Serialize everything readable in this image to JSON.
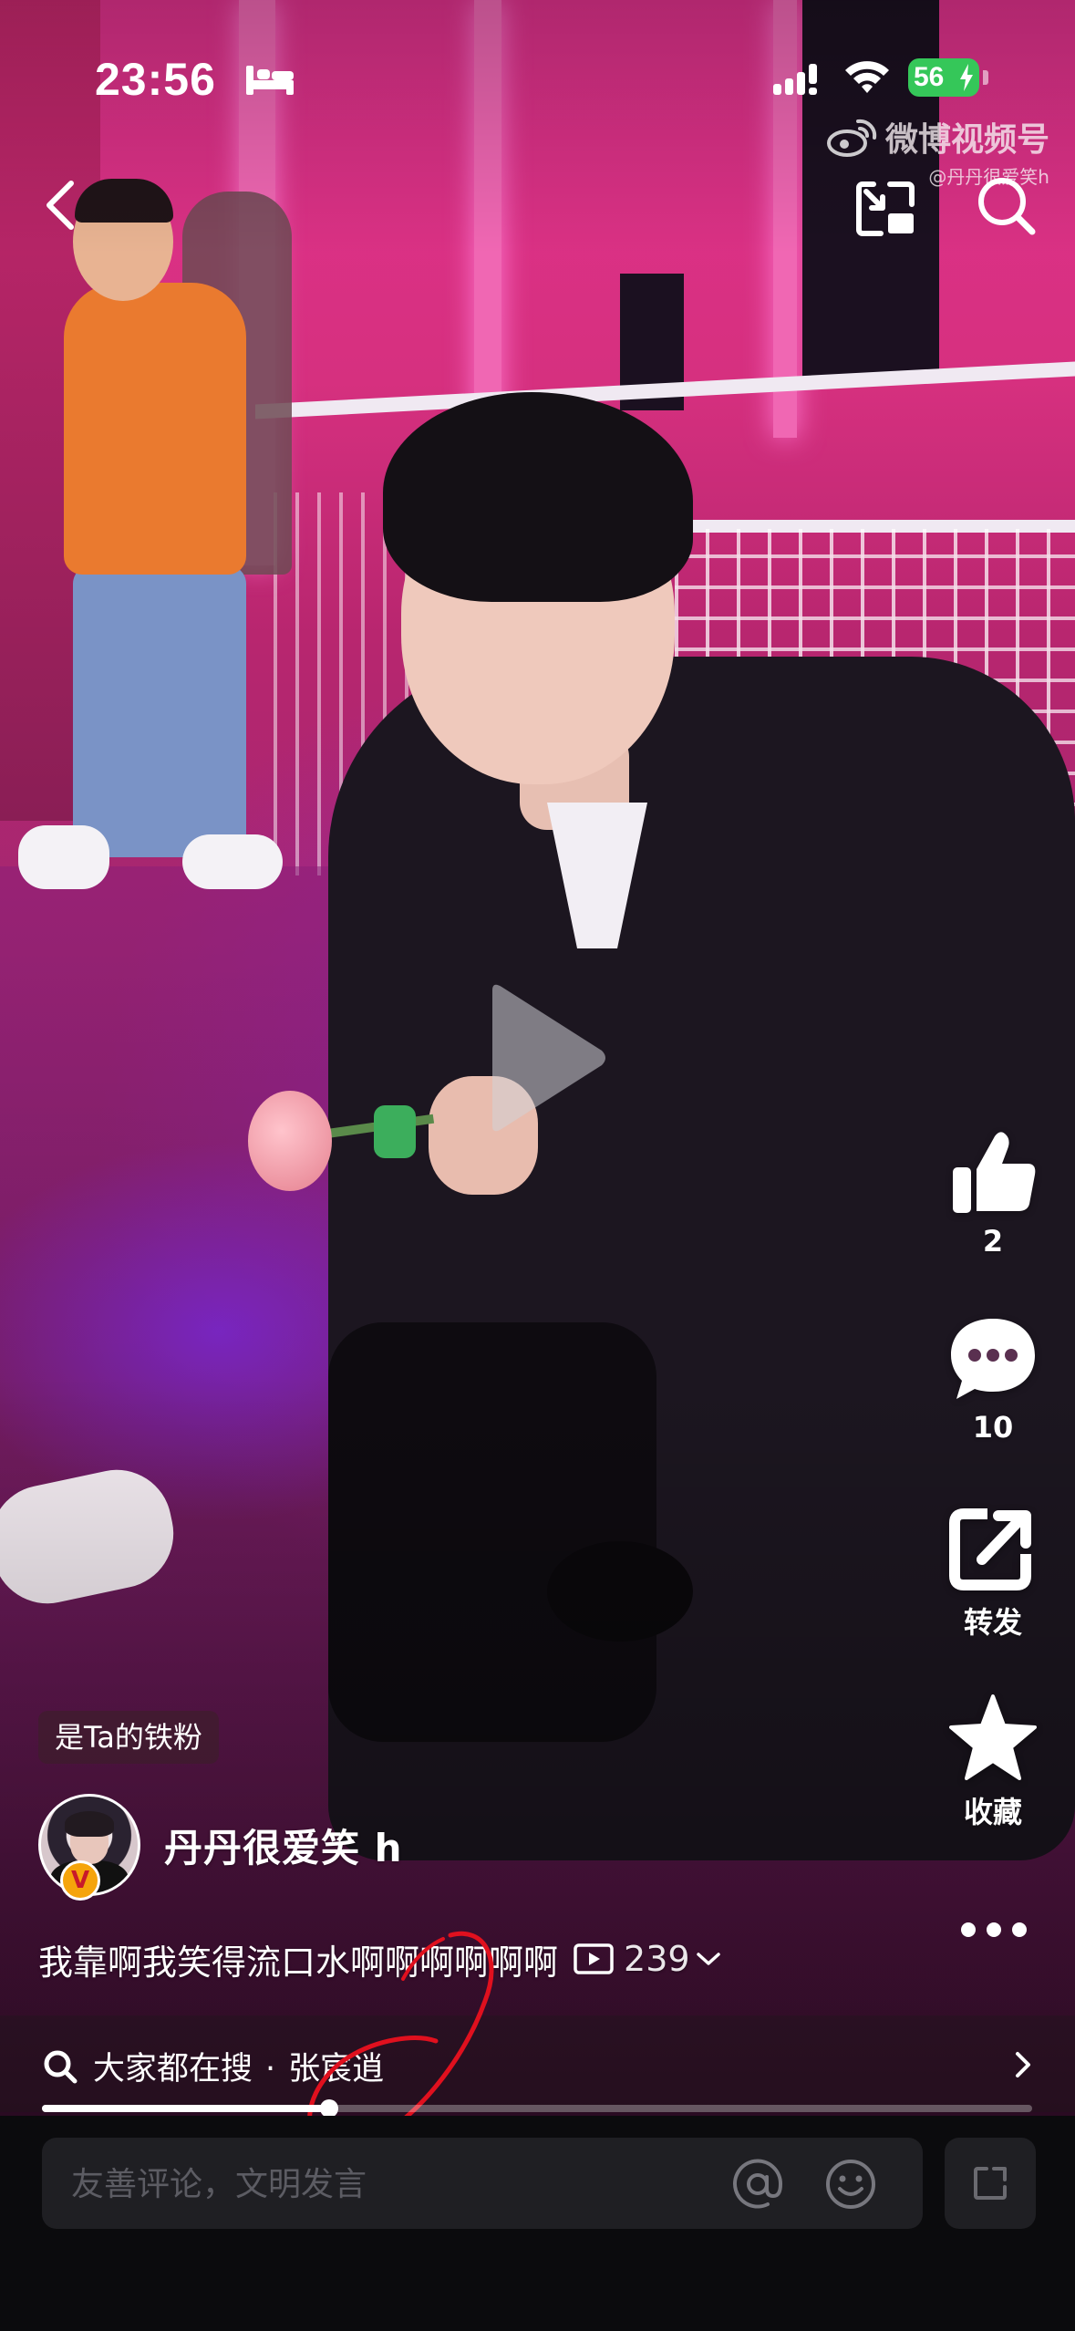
{
  "status_bar": {
    "time": "23:56",
    "battery": "56",
    "icons": [
      "bed-icon",
      "signal-icon",
      "wifi-icon",
      "battery-icon"
    ]
  },
  "watermark": {
    "brand": "微博视频号",
    "handle": "@丹丹很爱笑h"
  },
  "top_nav": {
    "icons": [
      "back-icon",
      "picture-in-picture-icon",
      "search-icon"
    ]
  },
  "video": {
    "state_icon": "play-icon",
    "progress": 0.29
  },
  "actions": {
    "like_count": "2",
    "comment_count": "10",
    "share_label": "转发",
    "favorite_label": "收藏",
    "icons": [
      "thumbs-up-icon",
      "comment-bubble-icon",
      "share-arrow-icon",
      "star-icon",
      "more-icon"
    ]
  },
  "author": {
    "fan_badge": "是Ta的铁粉",
    "name": "丹丹很爱笑 h",
    "verified_badge": "V"
  },
  "post": {
    "caption": "我靠啊我笑得流口水啊啊啊啊啊啊",
    "view_count": "239"
  },
  "search_strip": {
    "prefix": "大家都在搜",
    "separator": "·",
    "keyword": "张宸逍"
  },
  "comment_bar": {
    "placeholder": "友善评论，文明发言",
    "icons": [
      "at-icon",
      "emoji-icon",
      "expand-icon"
    ]
  },
  "colors": {
    "accent_battery": "#35c759",
    "annotation_red": "#e0101e",
    "bottom_bar": "#0b0b0d"
  }
}
